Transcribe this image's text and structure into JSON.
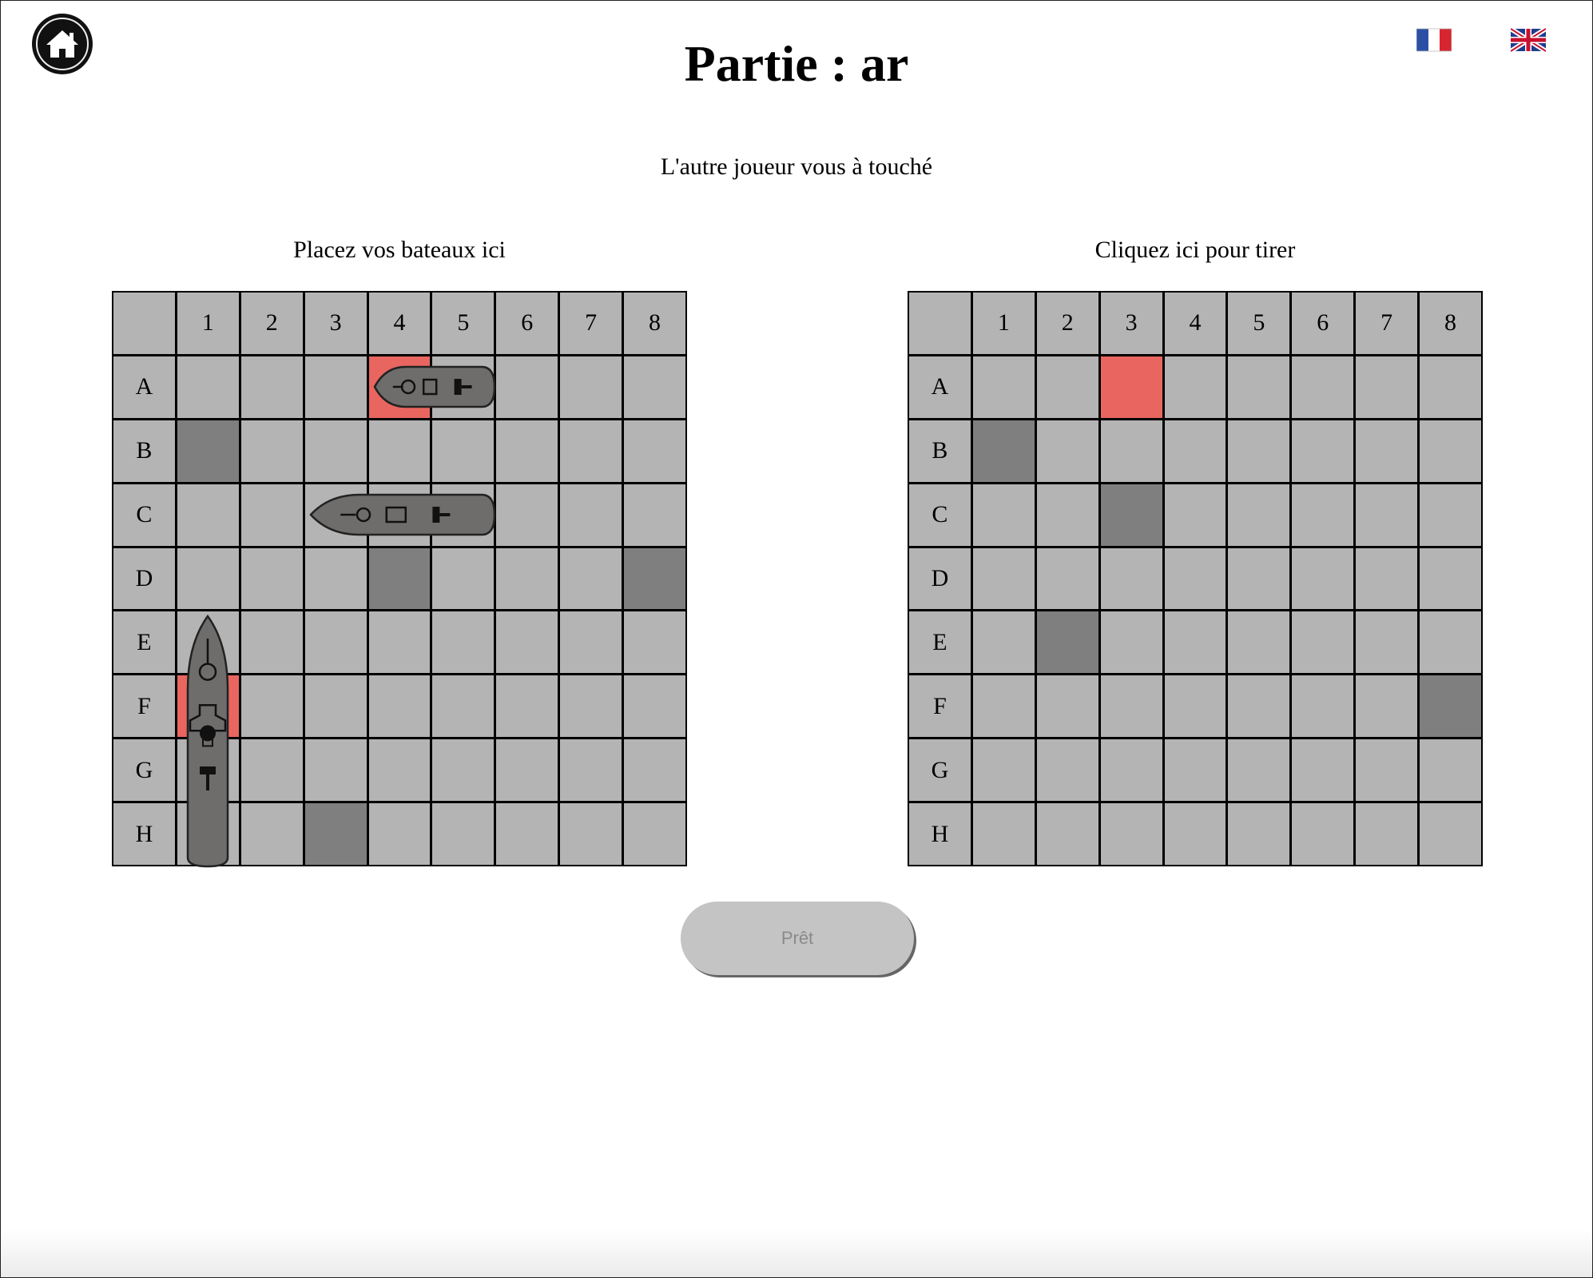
{
  "header": {
    "title": "Partie : ar",
    "home_icon": "home-icon",
    "languages": [
      {
        "code": "fr",
        "icon": "flag-france-icon"
      },
      {
        "code": "en",
        "icon": "flag-uk-icon"
      }
    ]
  },
  "status_message": "L'autre joueur vous à touché",
  "player_board": {
    "caption": "Placez vos bateaux ici",
    "misses": [
      "B1",
      "D4",
      "D8",
      "H3"
    ],
    "hits": [
      "A4",
      "F1"
    ],
    "ships": [
      {
        "start": "A4",
        "length": 2,
        "orientation": "horizontal"
      },
      {
        "start": "C3",
        "length": 3,
        "orientation": "horizontal"
      },
      {
        "start": "E1",
        "length": 4,
        "orientation": "vertical"
      }
    ]
  },
  "opponent_board": {
    "caption": "Cliquez ici pour tirer",
    "misses": [
      "B1",
      "C3",
      "E2",
      "F8"
    ],
    "hits": [
      "A3"
    ]
  },
  "grid": {
    "columns": [
      "1",
      "2",
      "3",
      "4",
      "5",
      "6",
      "7",
      "8"
    ],
    "rows": [
      "A",
      "B",
      "C",
      "D",
      "E",
      "F",
      "G",
      "H"
    ]
  },
  "ready_button": {
    "label": "Prêt",
    "enabled": false
  },
  "colors": {
    "cell": "#b5b4b5",
    "miss": "#7f7f7f",
    "hit": "#e8665f",
    "ship": "#6e6d6c",
    "button": "#c4c4c4"
  }
}
